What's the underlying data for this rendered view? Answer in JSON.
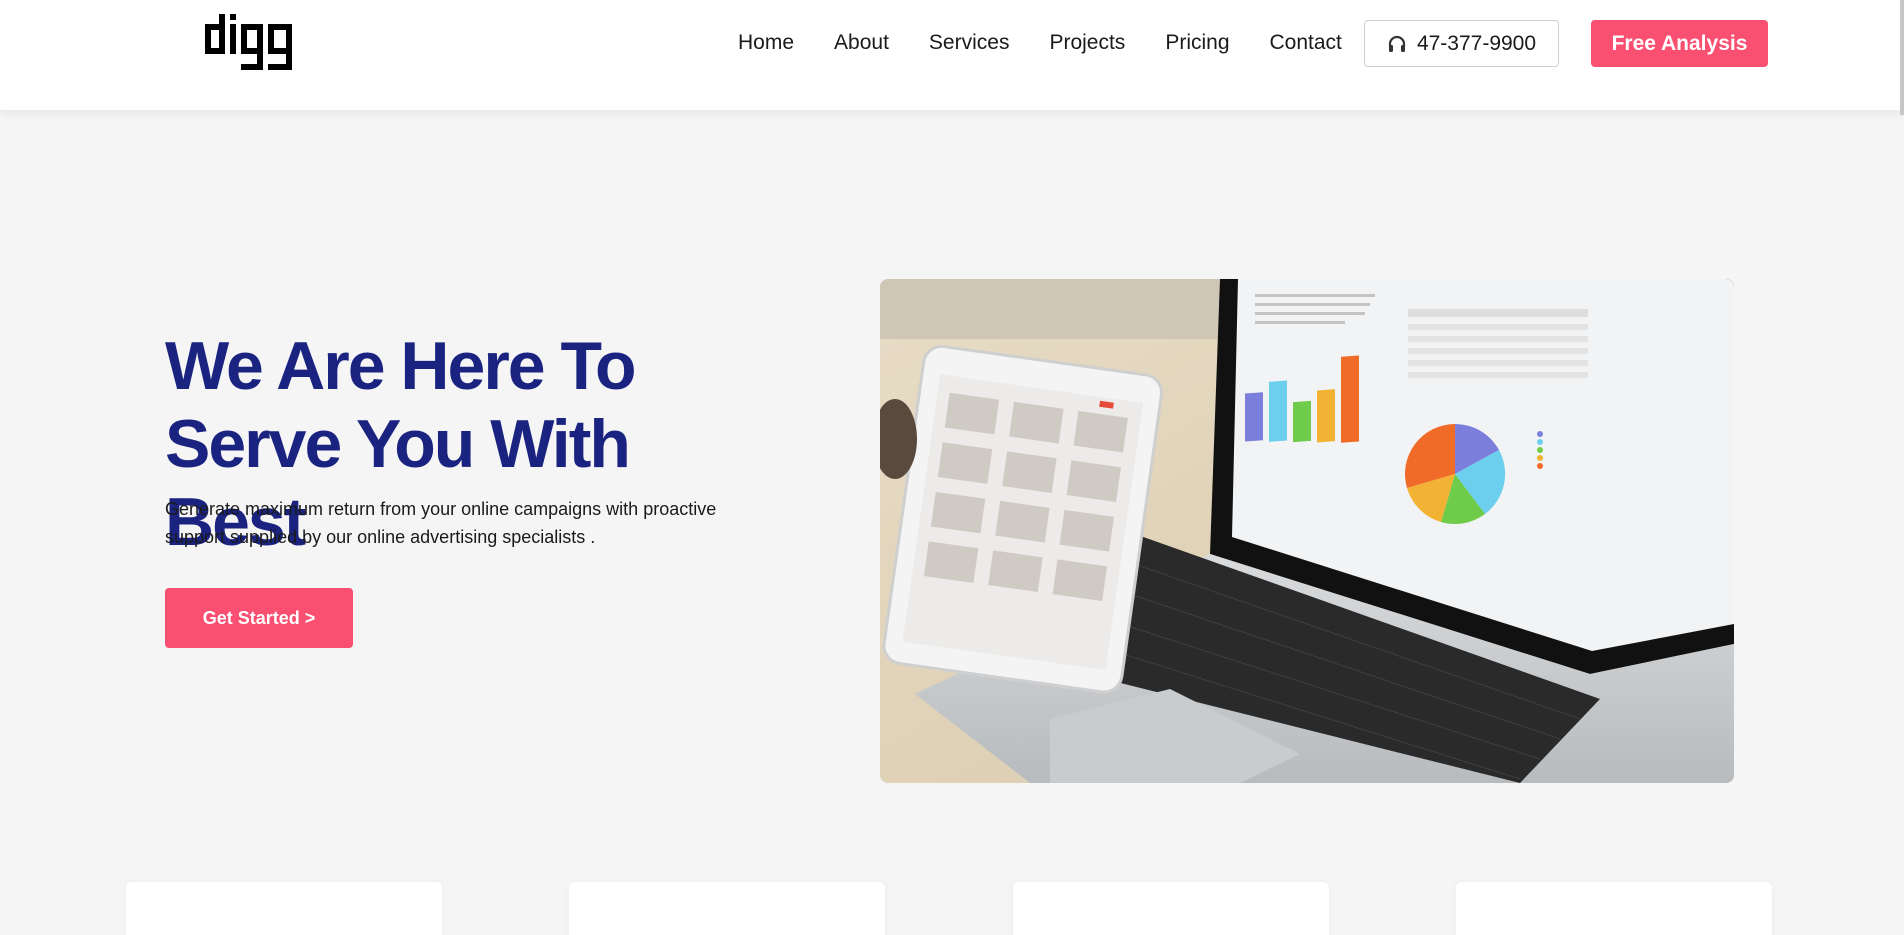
{
  "brand": {
    "logo_text": "digg",
    "accent": "#f94f71",
    "title_color": "#1b2380"
  },
  "nav": {
    "items": [
      {
        "label": "Home"
      },
      {
        "label": "About"
      },
      {
        "label": "Services"
      },
      {
        "label": "Projects"
      },
      {
        "label": "Pricing"
      },
      {
        "label": "Contact"
      }
    ],
    "phone": {
      "icon": "headphones-icon",
      "number": "47-377-9900"
    },
    "cta_label": "Free Analysis"
  },
  "hero": {
    "title_line1": "We Are Here To",
    "title_line2": "Serve You With Best",
    "subtitle": "Generate maximum return from your online campaigns with proactive support supplied by our online advertising specialists .",
    "button_label": "Get Started >",
    "image": "laptop-tablet-analytics-photo"
  }
}
